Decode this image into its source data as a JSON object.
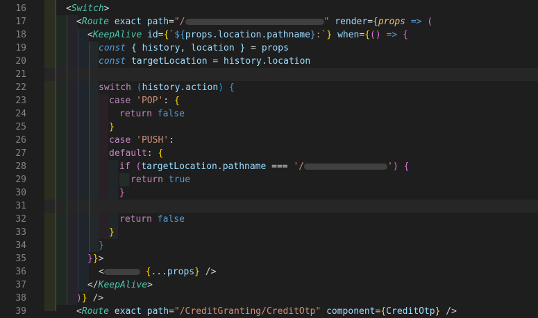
{
  "line_numbers": [
    "16",
    "17",
    "18",
    "19",
    "20",
    "21",
    "22",
    "23",
    "24",
    "25",
    "26",
    "27",
    "28",
    "29",
    "30",
    "31",
    "32",
    "33",
    "34",
    "35",
    "36",
    "37",
    "38",
    "39"
  ],
  "code": {
    "l16_tag": "Switch",
    "l17_tag": "Route",
    "l17_attr1": "exact",
    "l17_attr2": "path",
    "l17_str_start": "\"/",
    "l17_str_end": "\"",
    "l17_attr3": "render",
    "l17_param": "props",
    "l18_tag": "KeepAlive",
    "l18_attr1": "id",
    "l18_expr": "props.location.pathname",
    "l18_attr2": "when",
    "l19_kw": "const",
    "l19_body": "{ history, location }",
    "l19_rhs": "props",
    "l20_kw": "const",
    "l20_lhs": "targetLocation",
    "l20_rhs": "history.location",
    "l22_kw": "switch",
    "l22_expr": "history.action",
    "l23_kw": "case",
    "l23_str": "'POP'",
    "l24_kw": "return",
    "l24_val": "false",
    "l26_kw": "case",
    "l26_str": "'PUSH'",
    "l27_kw": "default",
    "l28_kw": "if",
    "l28_expr": "targetLocation.pathname",
    "l28_op": "===",
    "l28_str_start": "'/",
    "l28_str_end": "'",
    "l29_kw": "return",
    "l29_val": "true",
    "l32_kw": "return",
    "l32_val": "false",
    "l36_spread": "...props",
    "l37_tag": "KeepAlive",
    "l39_tag": "Route",
    "l39_attr1": "exact",
    "l39_attr2": "path",
    "l39_str": "\"/CreditGranting/CreditOtp\"",
    "l39_attr3": "component",
    "l39_comp": "CreditOtp"
  },
  "colors": {
    "background": "#1e1e1e",
    "keyword": "#c586c0",
    "constant": "#569cd6",
    "variable": "#9cdcfe",
    "string": "#ce9178",
    "tag": "#4ec9b0",
    "bracket_gold": "#ffd700",
    "bracket_orchid": "#da70d6",
    "bracket_blue": "#179fff"
  }
}
